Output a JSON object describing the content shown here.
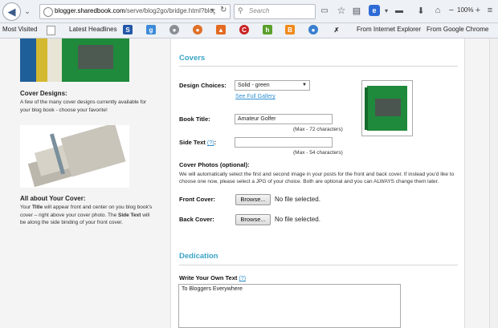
{
  "browser": {
    "url_domain": "blogger.sharedbook.com",
    "url_path": "/serve/blog2go/bridge.html?blog_",
    "search_placeholder": "Search",
    "zoom": "100%"
  },
  "bookmarks": {
    "most_visited": "Most Visited",
    "latest_headlines": "Latest Headlines",
    "from_ie": "From Internet Explorer",
    "from_chrome": "From Google Chrome"
  },
  "left": {
    "cover_designs_title": "Cover Designs:",
    "cover_designs_text": "A few of the many cover designs currently available for your blog book - choose your favorite!",
    "about_title": "All about Your Cover:",
    "about_p1": "Your ",
    "about_title_word": "Title",
    "about_p2": " will appear front and center on you blog book's cover – right above your cover photo. The ",
    "about_side_word": "Side Text",
    "about_p3": " will be along the side binding of your front cover."
  },
  "covers": {
    "section_title": "Covers",
    "design_label": "Design Choices:",
    "design_value": "Solid - green",
    "gallery_link": "See Full Gallery",
    "book_title_label": "Book Title:",
    "book_title_value": "Amateur Golfer",
    "book_title_note": "(Max - 72 characters)",
    "side_text_label": "Side Text ",
    "side_text_help": "(?)",
    "side_text_colon": ":",
    "side_text_value": "",
    "side_text_note": "(Max - 54 characters)",
    "photos_label": "Cover Photos (optional):",
    "photos_text": "We will automatically select the first and second image in your posts for the front and back cover. If instead you'd like to choose one now, please select a JPG of your choice. Both are optional and you can ALWAYS change them later.",
    "front_label": "Front Cover:",
    "back_label": "Back Cover:",
    "browse_label": "Browse...",
    "no_file": "No file selected."
  },
  "dedication": {
    "section_title": "Dedication",
    "write_label": "Write Your Own Text ",
    "help": "(?)",
    "text_value": "To Bloggers Everywhere"
  },
  "colors": {
    "accent": "#3aa3c6",
    "book_green": "#1f8a3b"
  }
}
